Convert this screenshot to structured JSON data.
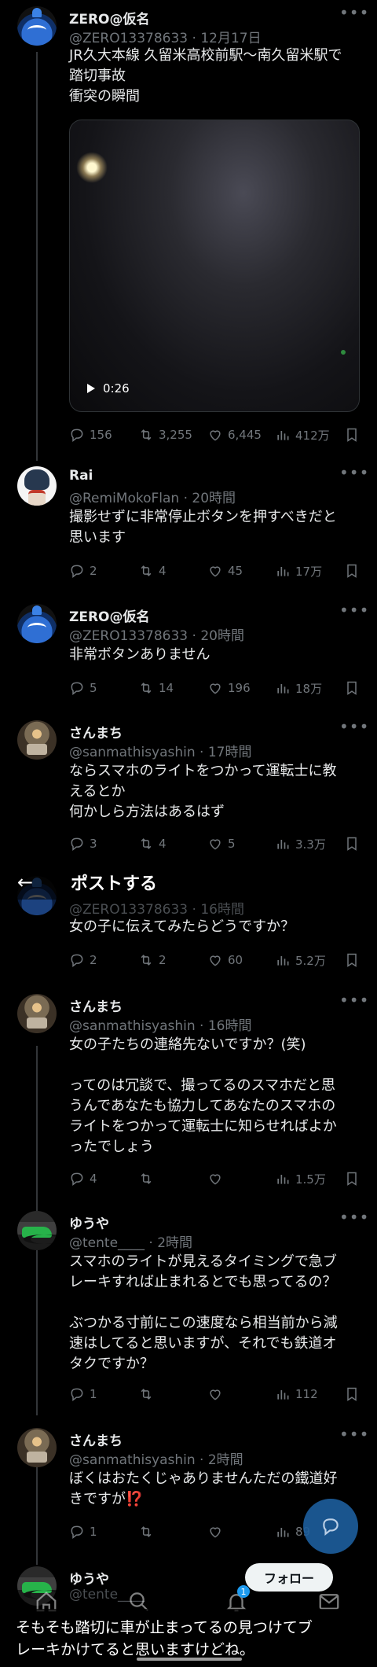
{
  "header": {
    "title": "ポストする",
    "back_icon": "arrow-left-icon"
  },
  "tweets": [
    {
      "name": "ZERO@仮名",
      "handle_time": "@ZERO13378633 · 12月17日",
      "text": "JR久大本線 久留米高校前駅〜南久留米駅で\n踏切事故\n衝突の瞬間",
      "video_duration": "0:26",
      "replies": "156",
      "retweets": "3,255",
      "likes": "6,445",
      "views": "412万"
    },
    {
      "name": "Rai",
      "handle_time": "@RemiMokoFlan · 20時間",
      "text": "撮影せずに非常停止ボタンを押すべきだと\n思います",
      "replies": "2",
      "retweets": "4",
      "likes": "45",
      "views": "17万"
    },
    {
      "name": "ZERO@仮名",
      "handle_time": "@ZERO13378633 · 20時間",
      "text": "非常ボタンありません",
      "replies": "5",
      "retweets": "14",
      "likes": "196",
      "views": "18万"
    },
    {
      "name": "さんまち",
      "handle_time": "@sanmathisyashin · 17時間",
      "text": "ならスマホのライトをつかって運転士に教\nえるとか\n何かしら方法はあるはず",
      "replies": "3",
      "retweets": "4",
      "likes": "5",
      "views": "3.3万"
    },
    {
      "name": "",
      "handle_time": "@ZERO13378633 · 16時間",
      "text": "女の子に伝えてみたらどうですか？",
      "replies": "2",
      "retweets": "2",
      "likes": "60",
      "views": "5.2万"
    },
    {
      "name": "さんまち",
      "handle_time": "@sanmathisyashin · 16時間",
      "text": "女の子たちの連絡先ないですか？(笑)\n\nってのは冗談で、撮ってるのスマホだと思\nうんであなたも協力してあなたのスマホの\nライトをつかって運転士に知らせればよか\nったでしょう",
      "replies": "4",
      "retweets": "",
      "likes": "",
      "views": "1.5万"
    },
    {
      "name": "ゆうや",
      "handle_time": "@tente____ · 2時間",
      "text": "スマホのライトが見えるタイミングで急ブ\nレーキすれば止まれるとでも思ってるの？\n\nぶつかる寸前にこの速度なら相当前から減\n速はしてると思いますが、それでも鉄道オ\nタクですか？",
      "replies": "1",
      "retweets": "",
      "likes": "",
      "views": "112"
    },
    {
      "name": "さんまち",
      "handle_time": "@sanmathisyashin · 2時間",
      "text": "ぼくはおたくじゃありませんただの鐵道好\nきですが⁉️",
      "replies": "1",
      "retweets": "",
      "likes": "",
      "views": "89"
    },
    {
      "name": "ゆうや",
      "handle_time": "@tente____",
      "text": ""
    }
  ],
  "follow_label": "フォロー",
  "notification_badge": "1",
  "composer_text": "そもそも踏切に車が止まってるの見つけてブ\nレーキかけてると思いますけどね。"
}
